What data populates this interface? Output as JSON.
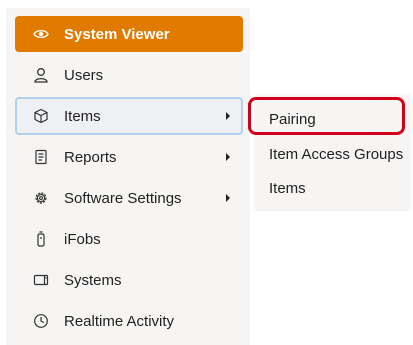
{
  "sidebar": {
    "items": [
      {
        "label": "System Viewer",
        "icon": "eye-icon",
        "active": true
      },
      {
        "label": "Users",
        "icon": "user-icon"
      },
      {
        "label": "Items",
        "icon": "cube-icon",
        "has_submenu": true,
        "open": true
      },
      {
        "label": "Reports",
        "icon": "report-icon",
        "has_submenu": true
      },
      {
        "label": "Software Settings",
        "icon": "gear-icon",
        "has_submenu": true
      },
      {
        "label": "iFobs",
        "icon": "fob-icon"
      },
      {
        "label": "Systems",
        "icon": "systems-icon"
      },
      {
        "label": "Realtime Activity",
        "icon": "clock-icon"
      }
    ]
  },
  "submenu": {
    "items": [
      {
        "label": "Pairing",
        "highlighted": true
      },
      {
        "label": "Item Access Groups"
      },
      {
        "label": "Items"
      }
    ]
  },
  "colors": {
    "active_bg": "#e07b00",
    "open_border": "#b3d1ef",
    "highlight": "#d0021b",
    "panel_bg": "#f6f5f3"
  }
}
